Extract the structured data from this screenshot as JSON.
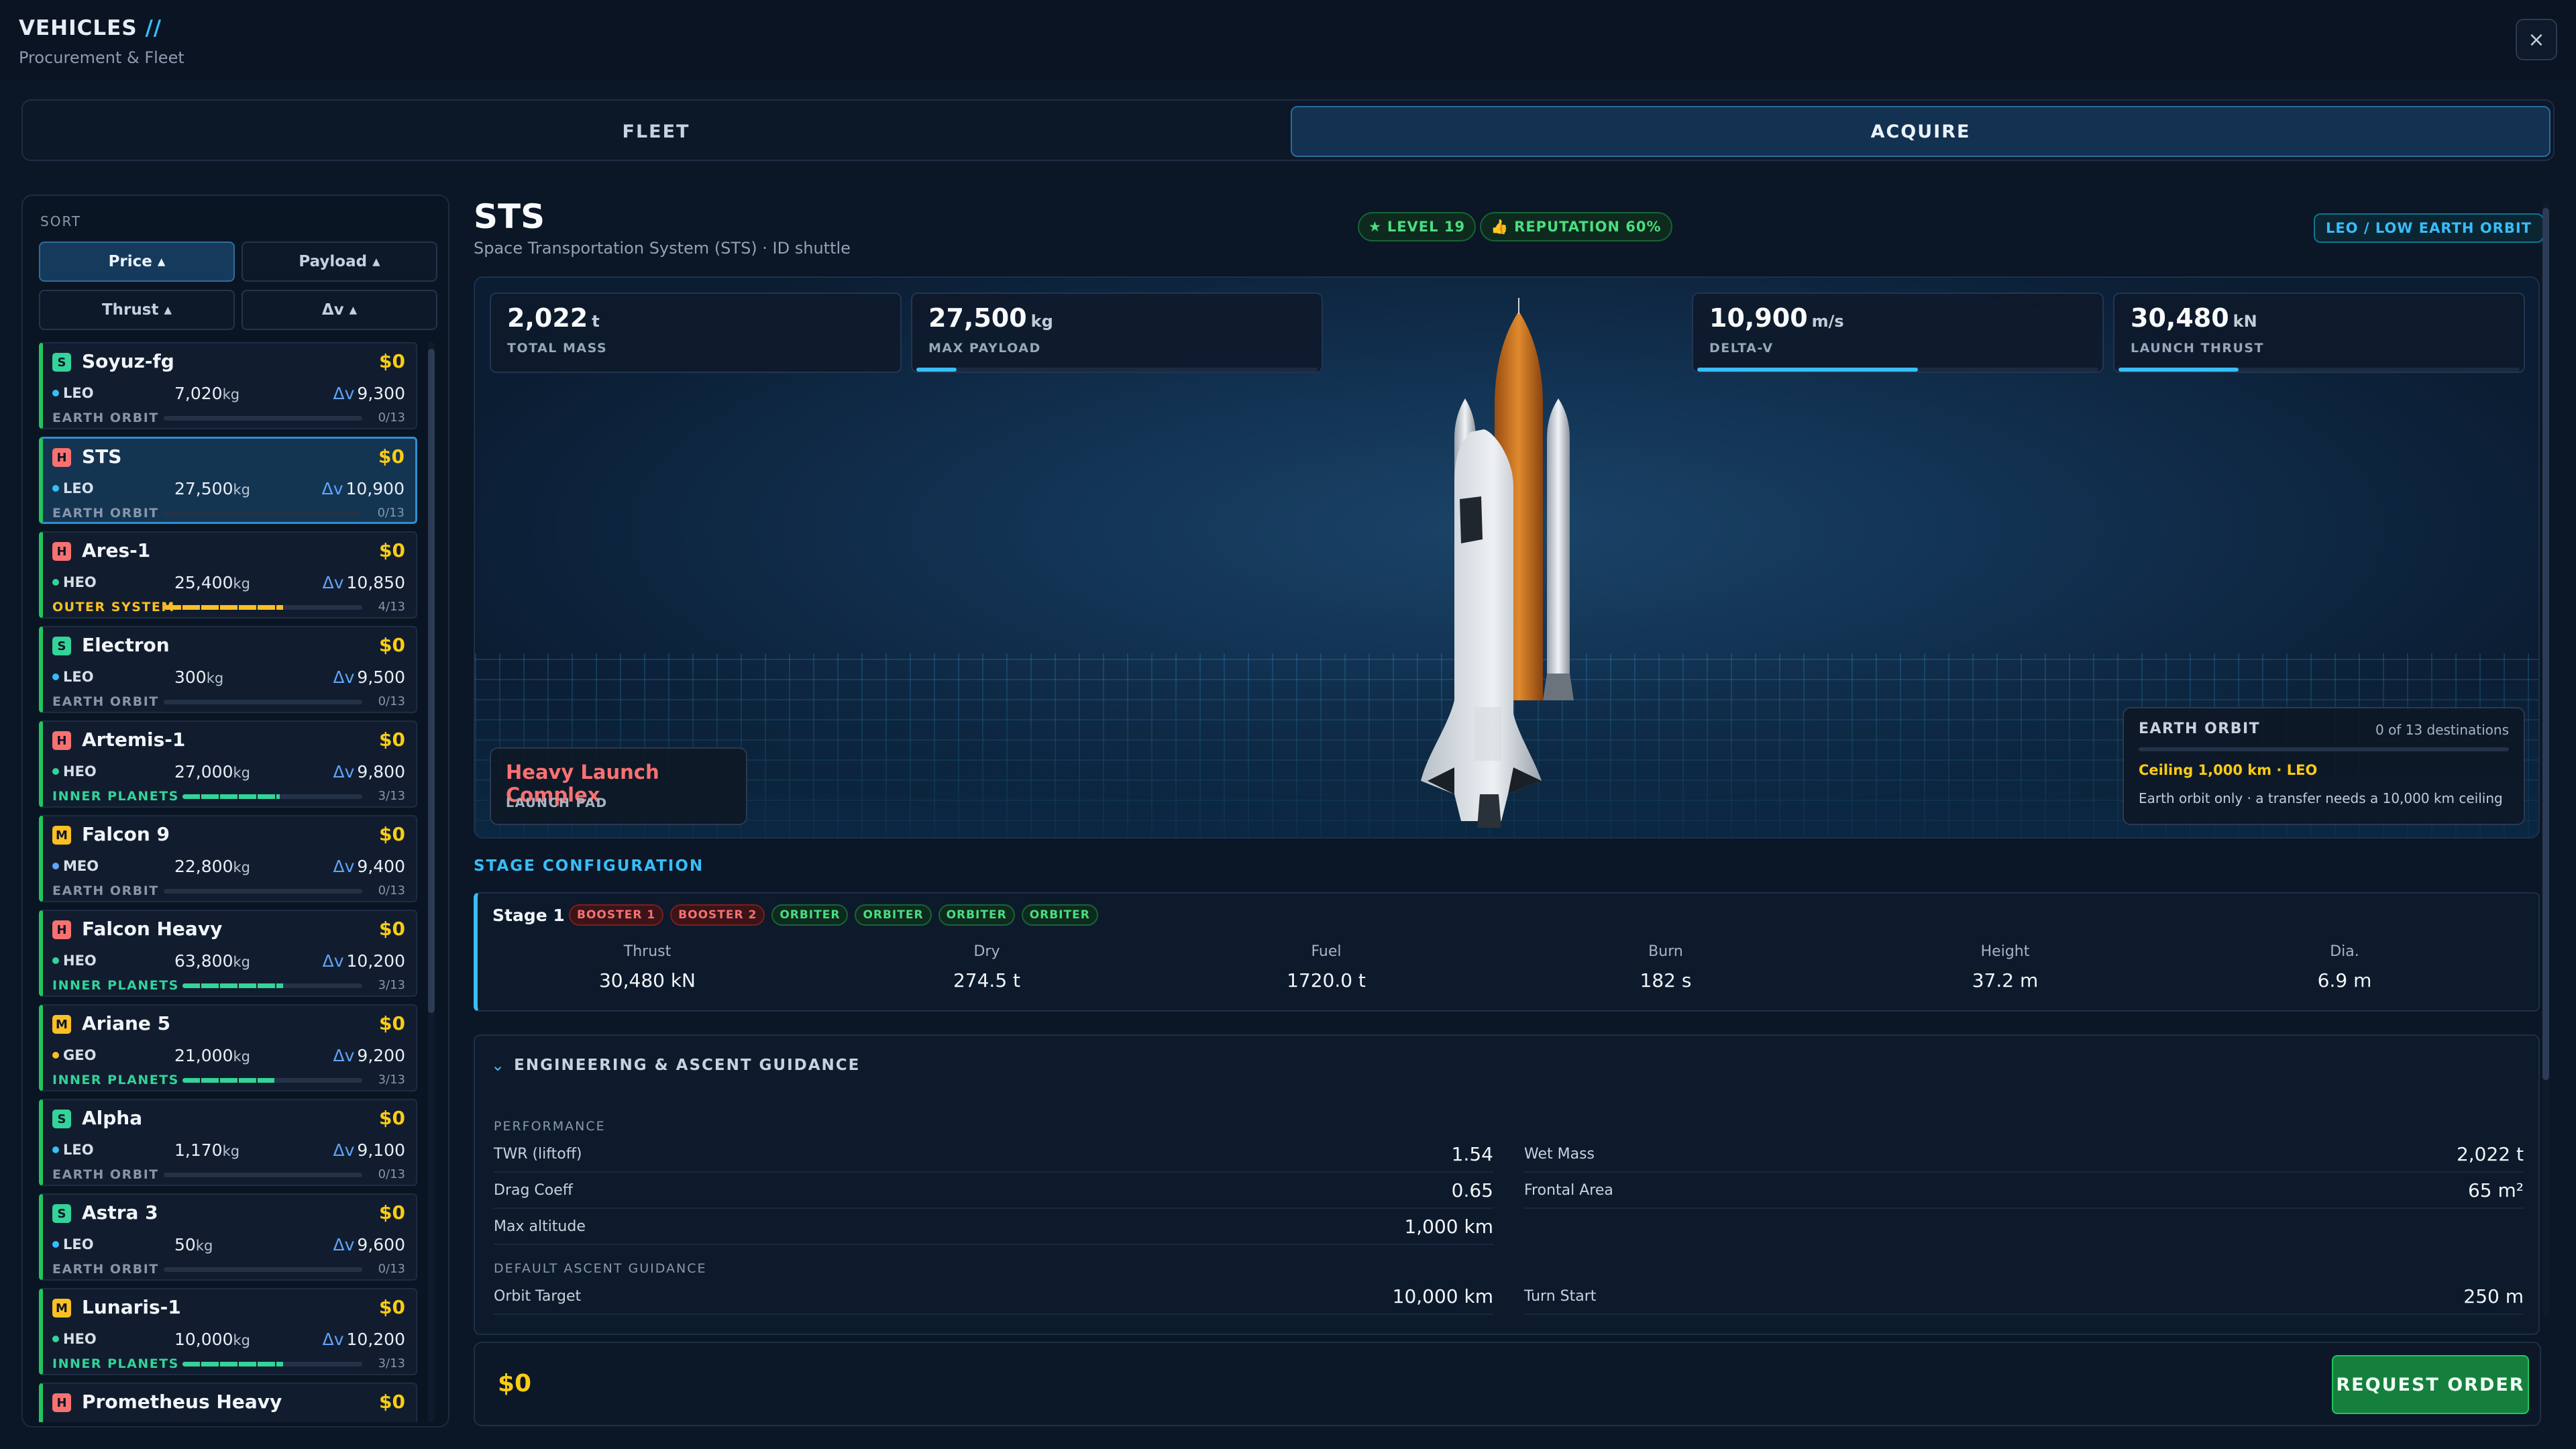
{
  "header": {
    "title": "VEHICLES",
    "title_mark": "//",
    "subtitle": "Procurement & Fleet",
    "close": "×"
  },
  "tabs": [
    {
      "label": "FLEET",
      "active": false
    },
    {
      "label": "ACQUIRE",
      "active": true
    }
  ],
  "sort": {
    "label": "SORT",
    "buttons": [
      "Price ▴",
      "Payload ▴",
      "Thrust ▴",
      "Δv ▴"
    ],
    "active": 0
  },
  "vehicles": [
    {
      "cls": "S",
      "name": "Soyuz-fg",
      "price": "$0",
      "orbit": "LEO",
      "orbit_color": "#38bdf8",
      "payload": "7,020",
      "unit": "kg",
      "dv": "9,300",
      "dest": "EARTH ORBIT",
      "count": "0/13",
      "progress": 0,
      "dest_color": "#8795aa"
    },
    {
      "cls": "H",
      "name": "STS",
      "price": "$0",
      "orbit": "LEO",
      "orbit_color": "#38bdf8",
      "payload": "27,500",
      "unit": "kg",
      "dv": "10,900",
      "dest": "EARTH ORBIT",
      "count": "0/13",
      "progress": 0,
      "dest_color": "#8795aa",
      "selected": true
    },
    {
      "cls": "H",
      "name": "Ares-1",
      "price": "$0",
      "orbit": "HEO",
      "orbit_color": "#34d399",
      "payload": "25,400",
      "unit": "kg",
      "dv": "10,850",
      "dest": "OUTER SYSTEM",
      "count": "4/13",
      "progress": 0.6,
      "dest_color": "#fbbf24"
    },
    {
      "cls": "S",
      "name": "Electron",
      "price": "$0",
      "orbit": "LEO",
      "orbit_color": "#38bdf8",
      "payload": "300",
      "unit": "kg",
      "dv": "9,500",
      "dest": "EARTH ORBIT",
      "count": "0/13",
      "progress": 0,
      "dest_color": "#8795aa"
    },
    {
      "cls": "H",
      "name": "Artemis-1",
      "price": "$0",
      "orbit": "HEO",
      "orbit_color": "#34d399",
      "payload": "27,000",
      "unit": "kg",
      "dv": "9,800",
      "dest": "INNER PLANETS",
      "count": "3/13",
      "progress": 0.54,
      "dest_color": "#34d399"
    },
    {
      "cls": "M",
      "name": "Falcon 9",
      "price": "$0",
      "orbit": "MEO",
      "orbit_color": "#60a5fa",
      "payload": "22,800",
      "unit": "kg",
      "dv": "9,400",
      "dest": "EARTH ORBIT",
      "count": "0/13",
      "progress": 0,
      "dest_color": "#8795aa"
    },
    {
      "cls": "H",
      "name": "Falcon Heavy",
      "price": "$0",
      "orbit": "HEO",
      "orbit_color": "#34d399",
      "payload": "63,800",
      "unit": "kg",
      "dv": "10,200",
      "dest": "INNER PLANETS",
      "count": "3/13",
      "progress": 0.56,
      "dest_color": "#34d399"
    },
    {
      "cls": "M",
      "name": "Ariane 5",
      "price": "$0",
      "orbit": "GEO",
      "orbit_color": "#fbbf24",
      "payload": "21,000",
      "unit": "kg",
      "dv": "9,200",
      "dest": "INNER PLANETS",
      "count": "3/13",
      "progress": 0.51,
      "dest_color": "#34d399"
    },
    {
      "cls": "S",
      "name": "Alpha",
      "price": "$0",
      "orbit": "LEO",
      "orbit_color": "#38bdf8",
      "payload": "1,170",
      "unit": "kg",
      "dv": "9,100",
      "dest": "EARTH ORBIT",
      "count": "0/13",
      "progress": 0,
      "dest_color": "#8795aa"
    },
    {
      "cls": "S",
      "name": "Astra 3",
      "price": "$0",
      "orbit": "LEO",
      "orbit_color": "#38bdf8",
      "payload": "50",
      "unit": "kg",
      "dv": "9,600",
      "dest": "EARTH ORBIT",
      "count": "0/13",
      "progress": 0,
      "dest_color": "#8795aa"
    },
    {
      "cls": "M",
      "name": "Lunaris-1",
      "price": "$0",
      "orbit": "HEO",
      "orbit_color": "#34d399",
      "payload": "10,000",
      "unit": "kg",
      "dv": "10,200",
      "dest": "INNER PLANETS",
      "count": "3/13",
      "progress": 0.56,
      "dest_color": "#34d399"
    },
    {
      "cls": "H",
      "name": "Prometheus Heavy",
      "price": "$0",
      "orbit": "",
      "orbit_color": "#34d399",
      "payload": "",
      "unit": "",
      "dv": "",
      "dest": "",
      "count": "",
      "progress": 0,
      "dest_color": "#8795aa"
    }
  ],
  "detail": {
    "name": "STS",
    "subtitle": "Space Transportation System (STS) · ID shuttle",
    "level": "LEVEL 19",
    "reputation": "REPUTATION 60%",
    "orbit_pill": "LEO / LOW EARTH ORBIT",
    "stats": [
      {
        "value": "2,022",
        "unit": "t",
        "label": "TOTAL MASS",
        "fill": 0
      },
      {
        "value": "27,500",
        "unit": "kg",
        "label": "MAX PAYLOAD",
        "fill": 0.1
      },
      {
        "value": "10,900",
        "unit": "m/s",
        "label": "DELTA-V",
        "fill": 0.55
      },
      {
        "value": "30,480",
        "unit": "kN",
        "label": "LAUNCH THRUST",
        "fill": 0.3
      }
    ],
    "pad": {
      "name": "Heavy Launch Complex",
      "label": "LAUNCH PAD"
    },
    "earth_orbit": {
      "title": "EARTH ORBIT",
      "count": "0 of 13 destinations",
      "ceiling": "Ceiling 1,000 km · LEO",
      "note": "Earth orbit only · a transfer needs a 10,000 km ceiling"
    }
  },
  "stage_config": {
    "heading": "STAGE CONFIGURATION",
    "title": "Stage 1",
    "tags": [
      {
        "label": "BOOSTER 1",
        "color": "red"
      },
      {
        "label": "BOOSTER 2",
        "color": "red"
      },
      {
        "label": "ORBITER",
        "color": "green"
      },
      {
        "label": "ORBITER",
        "color": "green"
      },
      {
        "label": "ORBITER",
        "color": "green"
      },
      {
        "label": "ORBITER",
        "color": "green"
      }
    ],
    "cols": [
      {
        "h": "Thrust",
        "v": "30,480 kN"
      },
      {
        "h": "Dry",
        "v": "274.5 t"
      },
      {
        "h": "Fuel",
        "v": "1720.0 t"
      },
      {
        "h": "Burn",
        "v": "182 s"
      },
      {
        "h": "Height",
        "v": "37.2 m"
      },
      {
        "h": "Dia.",
        "v": "6.9 m"
      }
    ]
  },
  "engineering": {
    "heading": "ENGINEERING & ASCENT GUIDANCE",
    "chevron": "⌄",
    "perf_label": "PERFORMANCE",
    "perf_left": [
      {
        "k": "TWR (liftoff)",
        "v": "1.54"
      },
      {
        "k": "Drag Coeff",
        "v": "0.65"
      },
      {
        "k": "Max altitude",
        "v": "1,000 km"
      }
    ],
    "perf_right": [
      {
        "k": "Wet Mass",
        "v": "2,022 t"
      },
      {
        "k": "Frontal Area",
        "v": "65 m²"
      }
    ],
    "guidance_label": "DEFAULT ASCENT GUIDANCE",
    "guid_left": [
      {
        "k": "Orbit Target",
        "v": "10,000 km"
      }
    ],
    "guid_right": [
      {
        "k": "Turn Start",
        "v": "250 m"
      }
    ]
  },
  "footer": {
    "price": "$0",
    "button": "REQUEST ORDER"
  }
}
